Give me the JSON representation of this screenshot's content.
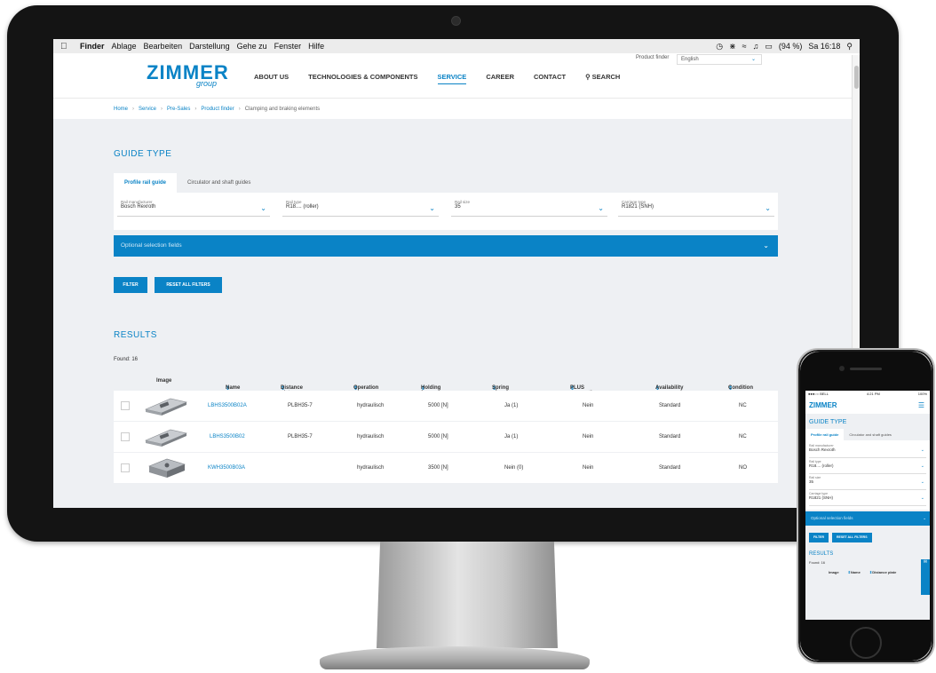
{
  "menubar": {
    "apple": "",
    "items": [
      "Finder",
      "Ablage",
      "Bearbeiten",
      "Darstellung",
      "Gehe zu",
      "Fenster",
      "Hilfe"
    ],
    "battery": "(94 %)",
    "clock": "Sa 16:18"
  },
  "header": {
    "logo": "ZIMMER",
    "logo_sub": "group",
    "product_finder": "Product finder",
    "language": "English",
    "nav": [
      "ABOUT US",
      "TECHNOLOGIES & COMPONENTS",
      "SERVICE",
      "CAREER",
      "CONTACT",
      "SEARCH"
    ]
  },
  "breadcrumb": [
    "Home",
    "Service",
    "Pre-Sales",
    "Product finder",
    "Clamping and braking elements"
  ],
  "guide": {
    "title": "GUIDE TYPE",
    "tabs": [
      "Profile rail guide",
      "Circulator and shaft guides"
    ],
    "selects": [
      {
        "label": "Rail manufacturer",
        "value": "Bosch Rexroth"
      },
      {
        "label": "Rail type",
        "value": "R18.... (roller)"
      },
      {
        "label": "Rail size",
        "value": "35"
      },
      {
        "label": "Carriage type",
        "value": "R1821 (SNH)"
      }
    ],
    "optional": "Optional selection fields"
  },
  "buttons": {
    "filter": "FILTER",
    "reset": "RESET ALL FILTERS"
  },
  "results": {
    "title": "RESULTS",
    "found": "Found: 16",
    "columns": [
      "Image",
      "Name",
      "Distance plate",
      "Operation",
      "Holding force",
      "Spring storage",
      "PLUS connection",
      "Availability",
      "Condition"
    ],
    "rows": [
      {
        "name": "LBHS3500B02A",
        "plate": "PLBH35-7",
        "operation": "hydraulisch",
        "force": "5000 [N]",
        "spring": "Ja (1)",
        "plus": "Nein",
        "availability": "Standard",
        "condition": "NC"
      },
      {
        "name": "LBHS3500B02",
        "plate": "PLBH35-7",
        "operation": "hydraulisch",
        "force": "5000 [N]",
        "spring": "Ja (1)",
        "plus": "Nein",
        "availability": "Standard",
        "condition": "NC"
      },
      {
        "name": "KWH3500B03A",
        "plate": "",
        "operation": "hydraulisch",
        "force": "3500 [N]",
        "spring": "Nein (0)",
        "plus": "Nein",
        "availability": "Standard",
        "condition": "NO"
      }
    ]
  },
  "phone": {
    "status_carrier": "●●●○○ BELL",
    "status_time": "4:21 PM",
    "status_battery": "100%",
    "logo": "ZIMMER",
    "title": "GUIDE TYPE",
    "tabs": [
      "Profile rail guide",
      "Circulator and shaft guides"
    ],
    "selects": [
      {
        "label": "Rail manufacturer",
        "value": "Bosch Rexroth"
      },
      {
        "label": "Rail type",
        "value": "R18.... (roller)"
      },
      {
        "label": "Rail size",
        "value": "35"
      },
      {
        "label": "Carriage type",
        "value": "R1821 (SNH)"
      }
    ],
    "optional": "Optional selection fields",
    "filter": "FILTER",
    "reset": "RESET ALL FILTERS",
    "results": "RESULTS",
    "found": "Found: 16",
    "columns": [
      "Image",
      "Name",
      "Distance plate"
    ]
  }
}
